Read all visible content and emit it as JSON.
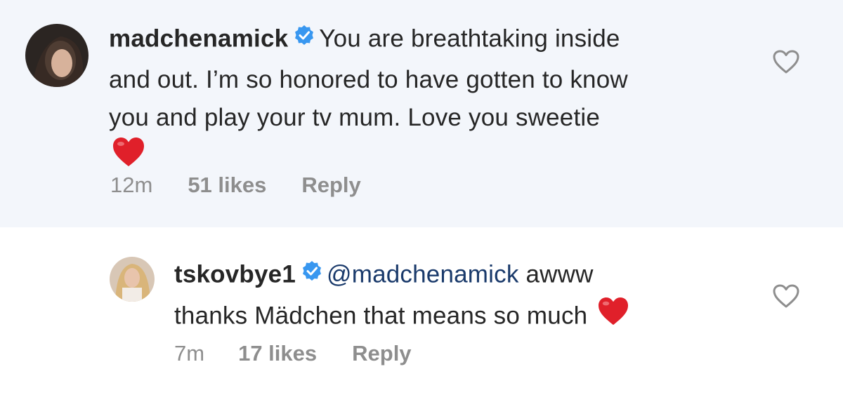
{
  "comments": [
    {
      "username": "madchenamick",
      "text_lines": [
        "You are breathtaking inside",
        "and out. I’m so honored to have gotten to know",
        "you and play your tv mum. Love you sweetie"
      ],
      "time": "12m",
      "likes": "51 likes",
      "reply_label": "Reply",
      "icons": {
        "verified": "verified-badge-icon",
        "emoji": "red-heart-emoji",
        "like": "heart-outline-icon"
      }
    },
    {
      "username": "tskovbye1",
      "mention": "@madchenamick",
      "text_lines": [
        "awww",
        "thanks Mädchen that means so much"
      ],
      "time": "7m",
      "likes": "17 likes",
      "reply_label": "Reply",
      "icons": {
        "verified": "verified-badge-icon",
        "emoji": "red-heart-emoji",
        "like": "heart-outline-icon"
      }
    }
  ],
  "colors": {
    "highlight_bg": "#f3f6fb",
    "verified": "#3897f0",
    "mention": "#1a3a6b",
    "meta_gray": "#8e8e8e",
    "heart_red": "#e0202a"
  }
}
